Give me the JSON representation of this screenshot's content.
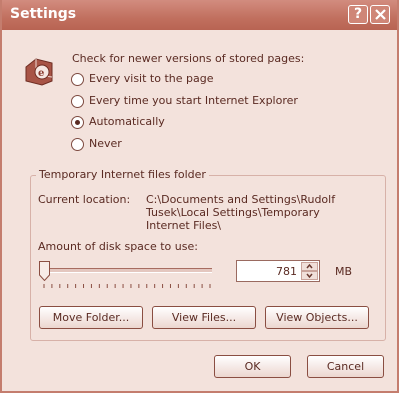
{
  "window": {
    "title": "Settings",
    "help_label": "?"
  },
  "check": {
    "heading": "Check for newer versions of stored pages:",
    "options": [
      {
        "label": "Every visit to the page",
        "selected": false
      },
      {
        "label": "Every time you start Internet Explorer",
        "selected": false
      },
      {
        "label": "Automatically",
        "selected": true
      },
      {
        "label": "Never",
        "selected": false
      }
    ]
  },
  "temp_files": {
    "legend": "Temporary Internet files folder",
    "location_label": "Current location:",
    "location_lines": [
      "C:\\Documents and Settings\\Rudolf",
      "Tusek\\Local Settings\\Temporary",
      "Internet Files\\"
    ],
    "disk_label": "Amount of disk space to use:",
    "disk_value": "781",
    "disk_unit": "MB",
    "slider_fraction": 0.0,
    "buttons": {
      "move_folder": "Move Folder...",
      "view_files": "View Files...",
      "view_objects": "View Objects..."
    }
  },
  "footer": {
    "ok": "OK",
    "cancel": "Cancel"
  },
  "colors": {
    "titlebar": "#c1705f",
    "dialog_bg": "#f3e2dc",
    "text": "#5a2a22"
  },
  "icons": [
    "ie-page-icon",
    "close-icon",
    "help-icon"
  ]
}
